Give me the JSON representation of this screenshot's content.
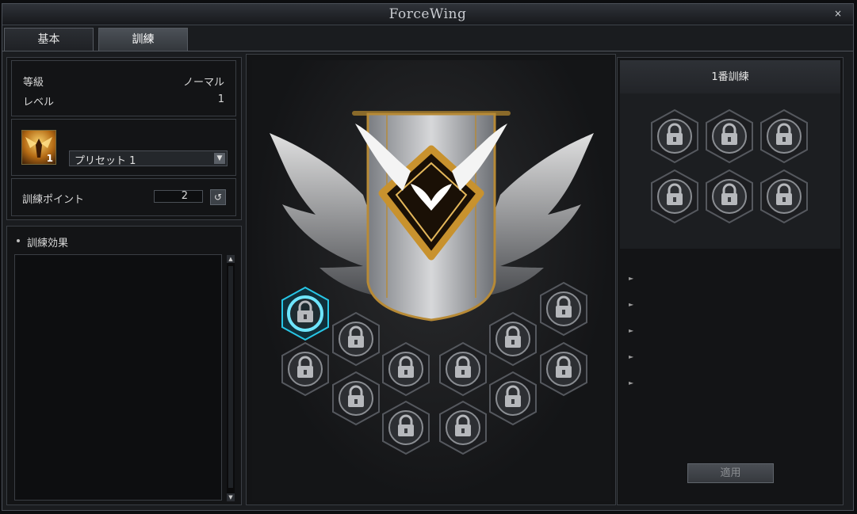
{
  "window": {
    "title": "ForceWing",
    "close_label": "×"
  },
  "tabs": [
    {
      "label": "基本",
      "active": false
    },
    {
      "label": "訓練",
      "active": true
    }
  ],
  "info": {
    "grade_label": "等級",
    "grade_value": "ノーマル",
    "level_label": "レベル",
    "level_value": "1"
  },
  "preset": {
    "badge": "1",
    "selected": "プリセット 1"
  },
  "points": {
    "label": "訓練ポイント",
    "value": "2"
  },
  "effects": {
    "title": "訓練効果"
  },
  "training": {
    "title": "1番訓練",
    "apply_label": "適用"
  },
  "colors": {
    "accent_glow": "#27c6e6",
    "gold": "#c8922e",
    "window_bg": "#1a1c1f"
  },
  "icons": {
    "node": "lock-icon",
    "selected_node": "lock-icon",
    "reset": "reset-icon"
  }
}
